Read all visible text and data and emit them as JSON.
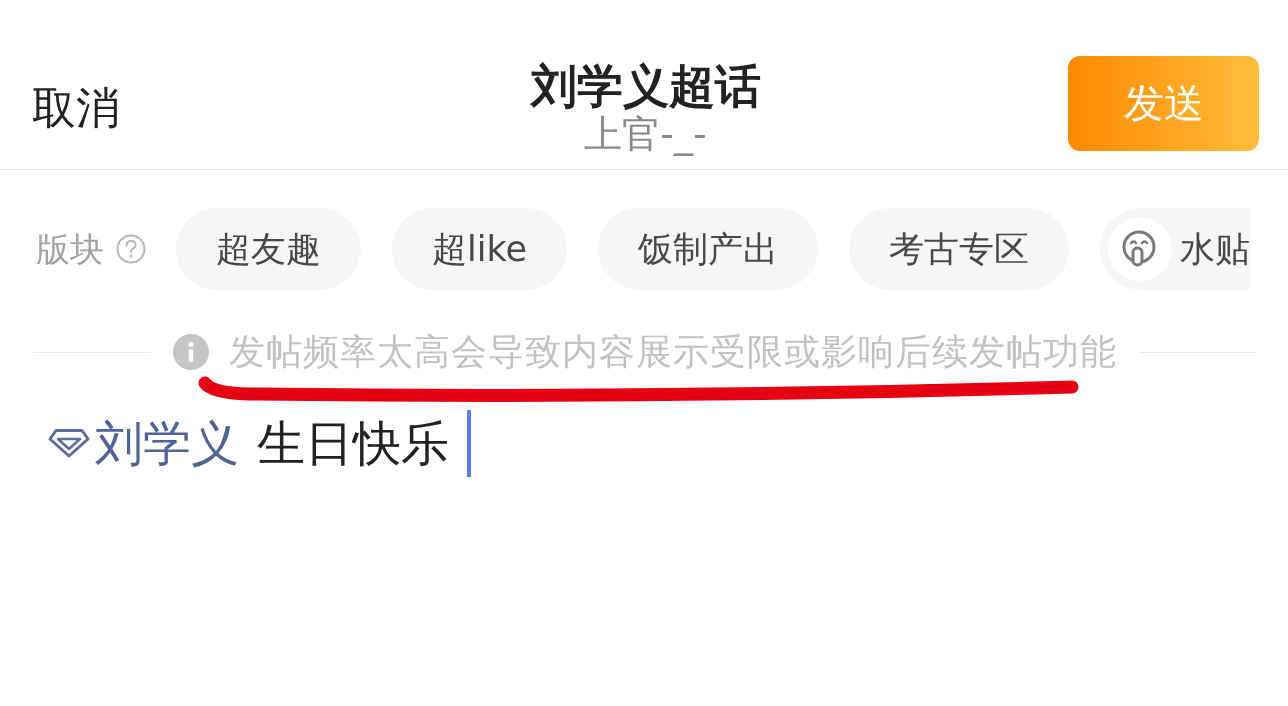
{
  "header": {
    "cancel": "取消",
    "title": "刘学义超话",
    "subtitle": "上官-_-",
    "send": "发送"
  },
  "sections": {
    "label": "版块",
    "chips": [
      {
        "label": "超友趣",
        "kind": "plain",
        "selected": false
      },
      {
        "label": "超like",
        "kind": "plain",
        "selected": false
      },
      {
        "label": "饭制产出",
        "kind": "plain",
        "selected": false
      },
      {
        "label": "考古专区",
        "kind": "plain",
        "selected": false
      },
      {
        "label": "水贴",
        "kind": "emoji",
        "selected": false
      }
    ]
  },
  "notice": {
    "text": "发帖频率太高会导致内容展示受限或影响后续发帖功能",
    "underlined": true
  },
  "editor": {
    "topic": "刘学义",
    "text": "生日快乐",
    "focused": true
  }
}
